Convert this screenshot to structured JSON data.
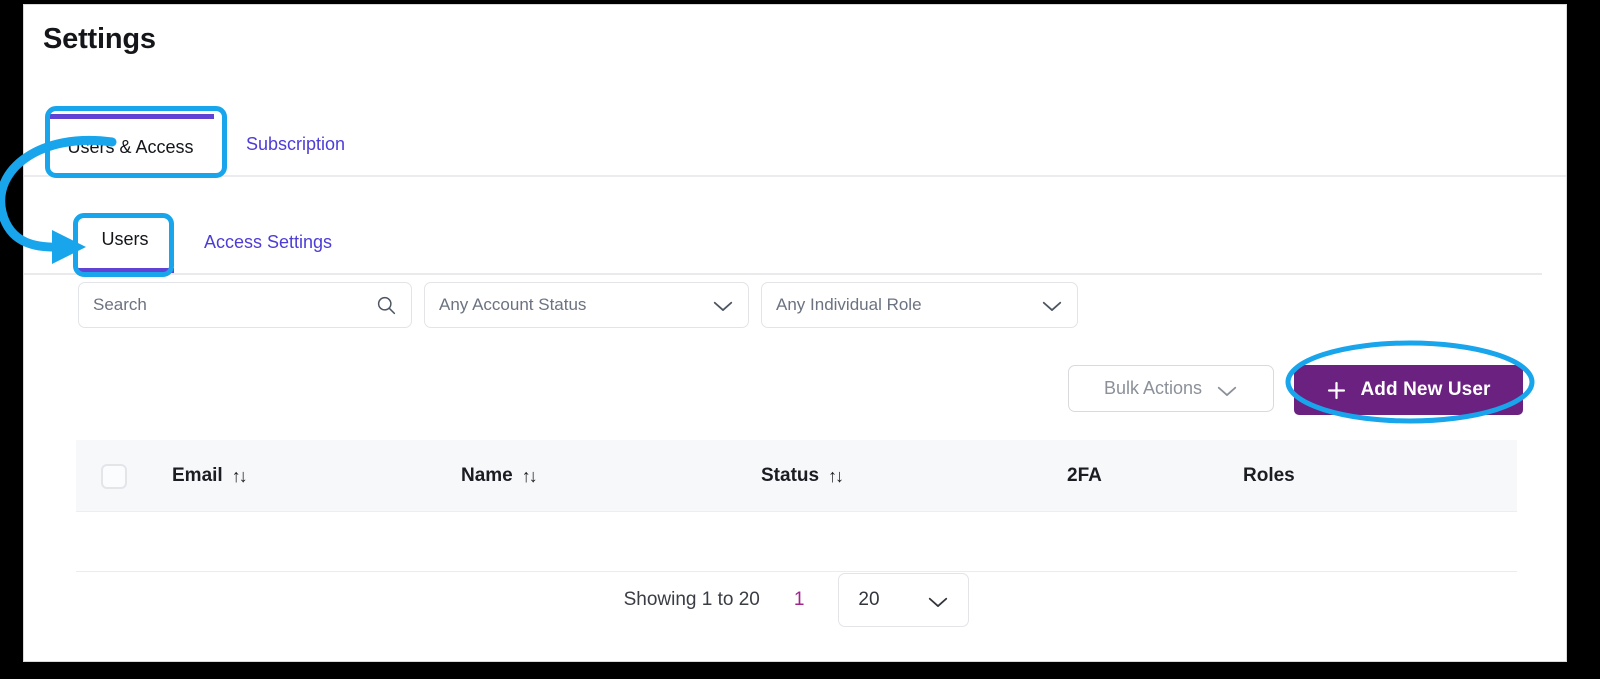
{
  "page": {
    "title": "Settings"
  },
  "primary_tabs": [
    {
      "label": "Users & Access",
      "active": true,
      "highlighted": true
    },
    {
      "label": "Subscription",
      "active": false,
      "highlighted": false
    }
  ],
  "secondary_tabs": [
    {
      "label": "Users",
      "active": true,
      "highlighted": true
    },
    {
      "label": "Access Settings",
      "active": false,
      "highlighted": false
    }
  ],
  "filters": {
    "search": {
      "value": "",
      "placeholder": "Search",
      "icon": "search-icon"
    },
    "account_status": {
      "value": "Any Account Status",
      "icon": "chevron-down-icon"
    },
    "individual_role": {
      "value": "Any Individual Role",
      "icon": "chevron-down-icon"
    }
  },
  "actions": {
    "bulk_actions": {
      "label": "Bulk Actions",
      "icon": "chevron-down-icon"
    },
    "add_new_user": {
      "label": "Add New User",
      "icon": "plus-icon",
      "highlighted": true
    }
  },
  "table": {
    "select_all_checkbox": {
      "checked": false
    },
    "columns": [
      {
        "label": "Email",
        "sortable": true,
        "sort_icon": "↑↓"
      },
      {
        "label": "Name",
        "sortable": true,
        "sort_icon": "↑↓"
      },
      {
        "label": "Status",
        "sortable": true,
        "sort_icon": "↑↓"
      },
      {
        "label": "2FA",
        "sortable": false,
        "sort_icon": ""
      },
      {
        "label": "Roles",
        "sortable": false,
        "sort_icon": ""
      }
    ],
    "rows": []
  },
  "pagination": {
    "showing": "Showing 1 to 20",
    "current_page": "1",
    "per_page": "20",
    "per_page_icon": "chevron-down-icon"
  },
  "annotations": {
    "color": "#18a5ec",
    "arrow": "curved-arrow-from-users-access-tab-to-users-subtab",
    "ellipse_target": "add-new-user-button"
  },
  "colors": {
    "accent_purple": "#6043d4",
    "link_purple": "#4d3dd6",
    "button_purple": "#6b2180",
    "page_number_magenta": "#a0248d",
    "annotation_cyan": "#18a5ec"
  }
}
